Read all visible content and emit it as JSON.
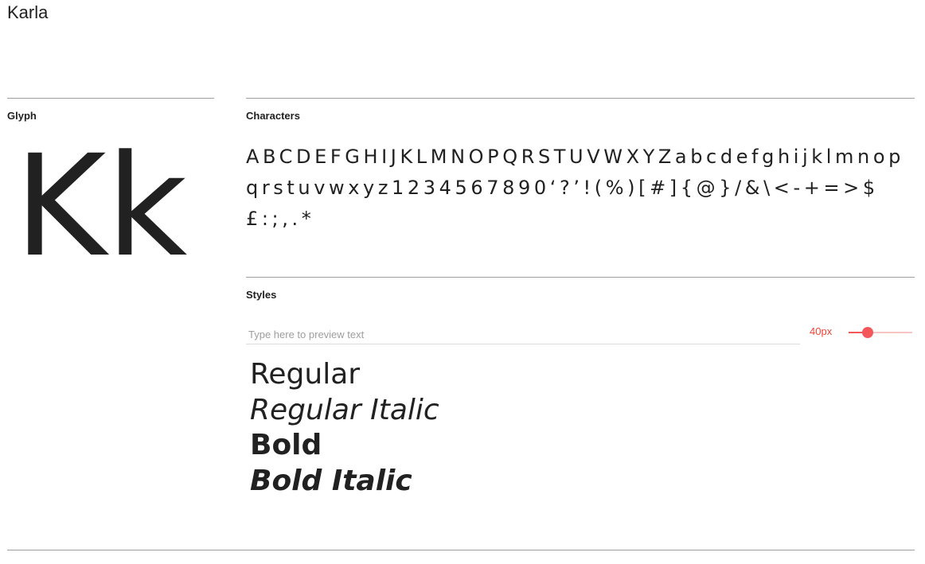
{
  "font": {
    "name": "Karla"
  },
  "glyph": {
    "label": "Glyph",
    "sample": "Kk"
  },
  "characters": {
    "label": "Characters",
    "text": "ABCDEFGHIJKLMNOPQRSTUVWXYZabcdefghijklmnopqrstuvwxyz1234567890‘?’!(%)[#]{@}/&\\<-+=>$£:;,.*"
  },
  "styles": {
    "label": "Styles",
    "preview_placeholder": "Type here to preview text",
    "size_value": "40px",
    "size_slider_level": 0.3,
    "samples": [
      "Regular",
      "Regular Italic",
      "Bold",
      "Bold Italic"
    ]
  },
  "colors": {
    "accent": "#f4575a",
    "accent_text": "#f44336",
    "rule": "#9e9e9e",
    "text": "#212121"
  }
}
